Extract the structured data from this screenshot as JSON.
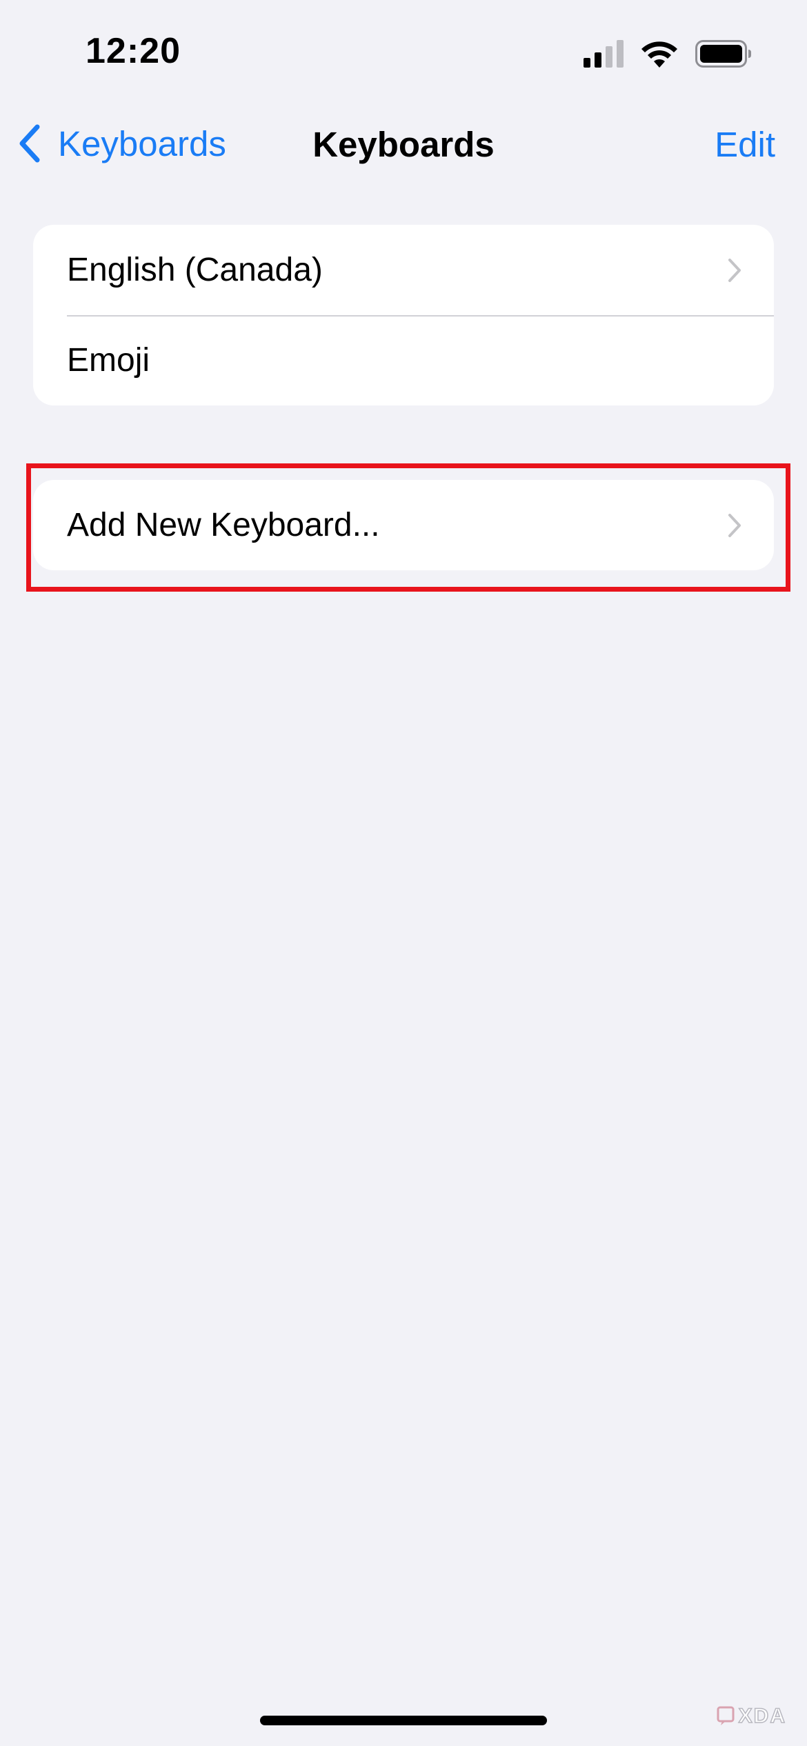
{
  "status_bar": {
    "time": "12:20",
    "icons": [
      "cellular-signal-icon",
      "wifi-icon",
      "battery-icon"
    ]
  },
  "nav": {
    "back_label": "Keyboards",
    "title": "Keyboards",
    "edit_label": "Edit"
  },
  "keyboards": [
    {
      "label": "English (Canada)",
      "has_chevron": true
    },
    {
      "label": "Emoji",
      "has_chevron": false
    }
  ],
  "add_keyboard": {
    "label": "Add New Keyboard..."
  },
  "watermark": {
    "text": "XDA"
  },
  "colors": {
    "accent": "#1a7cf5",
    "background": "#f2f2f7",
    "highlight": "#e8141c",
    "chevron": "#c4c4c7"
  }
}
